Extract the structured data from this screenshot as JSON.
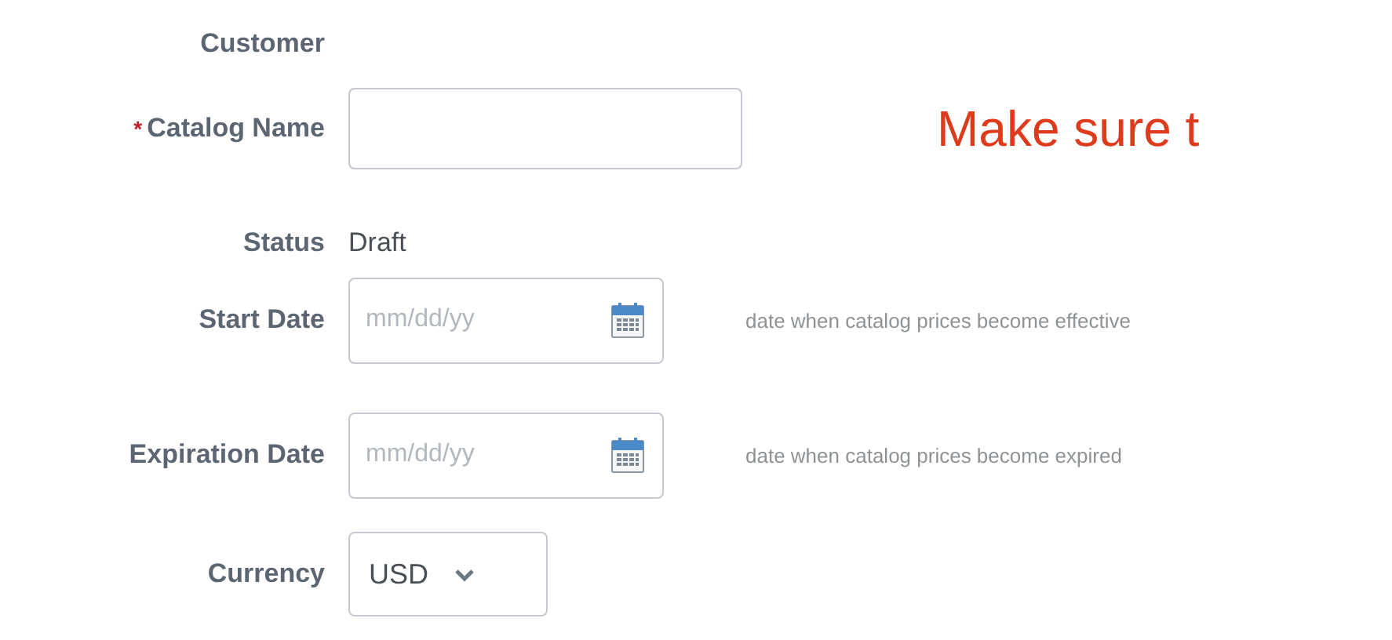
{
  "fields": [
    {
      "kind": "empty",
      "label": "Customer"
    },
    {
      "kind": "text",
      "label": "Catalog Name",
      "required_mark": "*"
    },
    {
      "kind": "static",
      "label": "Status",
      "value": "Draft"
    },
    {
      "kind": "date",
      "label": "Start Date",
      "placeholder": "mm/dd/yy",
      "hint": "date when catalog prices become effective"
    },
    {
      "kind": "date",
      "label": "Expiration Date",
      "placeholder": "mm/dd/yy",
      "hint": "date when catalog prices become expired"
    },
    {
      "kind": "select",
      "label": "Currency",
      "value": "USD"
    }
  ],
  "notice": "Make sure t"
}
